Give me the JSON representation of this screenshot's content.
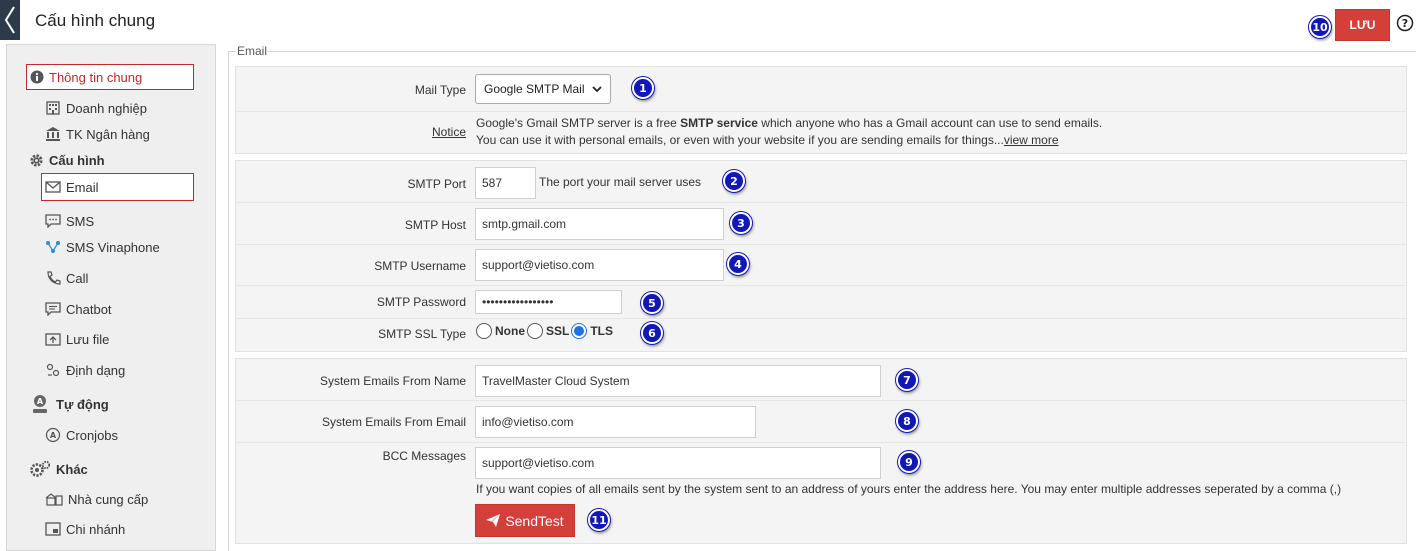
{
  "header": {
    "title": "Cấu hình chung",
    "save_label": "LƯU",
    "save_badge": "10"
  },
  "sidebar": {
    "items": [
      {
        "label": "Thông tin chung",
        "icon": "info-icon"
      },
      {
        "label": "Doanh nghiệp",
        "icon": "building-icon"
      },
      {
        "label": "TK Ngân hàng",
        "icon": "bank-icon"
      },
      {
        "label": "Cấu hình",
        "icon": "gear-icon"
      },
      {
        "label": "Email",
        "icon": "mail-icon"
      },
      {
        "label": "SMS",
        "icon": "sms-icon"
      },
      {
        "label": "SMS Vinaphone",
        "icon": "share-icon"
      },
      {
        "label": "Call",
        "icon": "phone-icon"
      },
      {
        "label": "Chatbot",
        "icon": "chat-icon"
      },
      {
        "label": "Lưu file",
        "icon": "upload-icon"
      },
      {
        "label": "Định dạng",
        "icon": "format-icon"
      },
      {
        "label": "Tự động",
        "icon": "auto-icon"
      },
      {
        "label": "Cronjobs",
        "icon": "cron-icon"
      },
      {
        "label": "Khác",
        "icon": "gears-icon"
      },
      {
        "label": "Nhà cung cấp",
        "icon": "supplier-icon"
      },
      {
        "label": "Chi nhánh",
        "icon": "branch-icon"
      }
    ]
  },
  "form": {
    "legend": "Email",
    "mail_type": {
      "label": "Mail Type",
      "value": "Google SMTP Mail",
      "badge": "1"
    },
    "notice": {
      "label": "Notice",
      "line1_pre": "Google's Gmail SMTP server is a free ",
      "line1_bold": "SMTP service",
      "line1_post": " which anyone who has a Gmail account  can use to send emails.",
      "line2": "You can use it with personal emails, or even with your website if you are sending emails for things...",
      "view_more": "view more"
    },
    "smtp_port": {
      "label": "SMTP Port",
      "value": "587",
      "hint": "The port your mail server uses",
      "badge": "2"
    },
    "smtp_host": {
      "label": "SMTP Host",
      "value": "smtp.gmail.com",
      "badge": "3"
    },
    "smtp_username": {
      "label": "SMTP Username",
      "value": "support@vietiso.com",
      "badge": "4"
    },
    "smtp_password": {
      "label": "SMTP Password",
      "value": "•••••••••••••••••",
      "badge": "5"
    },
    "smtp_ssl": {
      "label": "SMTP SSL Type",
      "options": [
        "None",
        "SSL",
        "TLS"
      ],
      "selected": "TLS",
      "badge": "6"
    },
    "from_name": {
      "label": "System Emails From Name",
      "value": "TravelMaster Cloud System",
      "badge": "7"
    },
    "from_email": {
      "label": "System Emails From Email",
      "value": "info@vietiso.com",
      "badge": "8"
    },
    "bcc": {
      "label": "BCC Messages",
      "value": "support@vietiso.com",
      "badge": "9",
      "help": "If you want copies of all emails sent by the system sent to an address of yours enter the address here. You may enter multiple addresses seperated by a comma (,)"
    },
    "send_test": {
      "label": "SendTest",
      "badge": "11"
    }
  },
  "colors": {
    "accent": "#d43f3a",
    "badge": "#1218b8",
    "radio": "#1a73e8"
  }
}
